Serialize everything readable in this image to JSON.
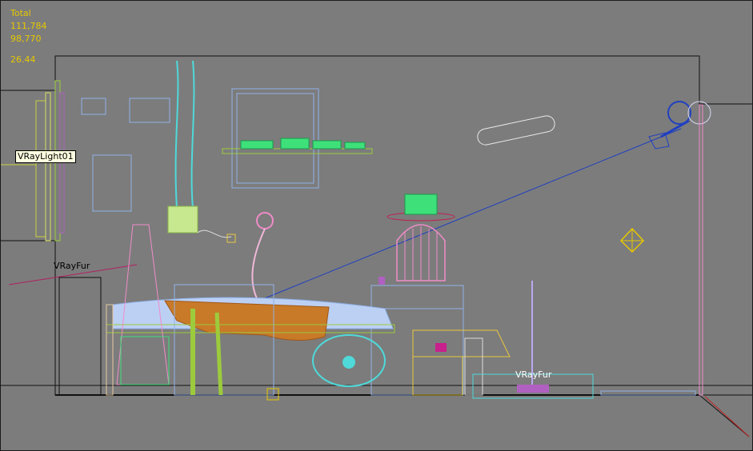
{
  "viewport": {
    "stats": {
      "total_label": "Total",
      "polys": "111,784",
      "verts": "98,770",
      "fps": "26.44"
    },
    "objects": {
      "light_label": "VRayLight01",
      "fur_label_1": "VRayFur",
      "fur_label_2": "VRayFur"
    }
  },
  "colors": {
    "background": "#7c7c7c",
    "stats_text": "#e6c800",
    "wire_blue": "#8fb2e8",
    "wire_cyan": "#4fd9d9",
    "wire_green": "#3ee07a",
    "wire_pink": "#f08cc8",
    "wire_orange": "#c87a28",
    "wire_yellow": "#e8c840",
    "wire_olive": "#9ccb3c",
    "wire_lavender": "#c0b8f0"
  }
}
